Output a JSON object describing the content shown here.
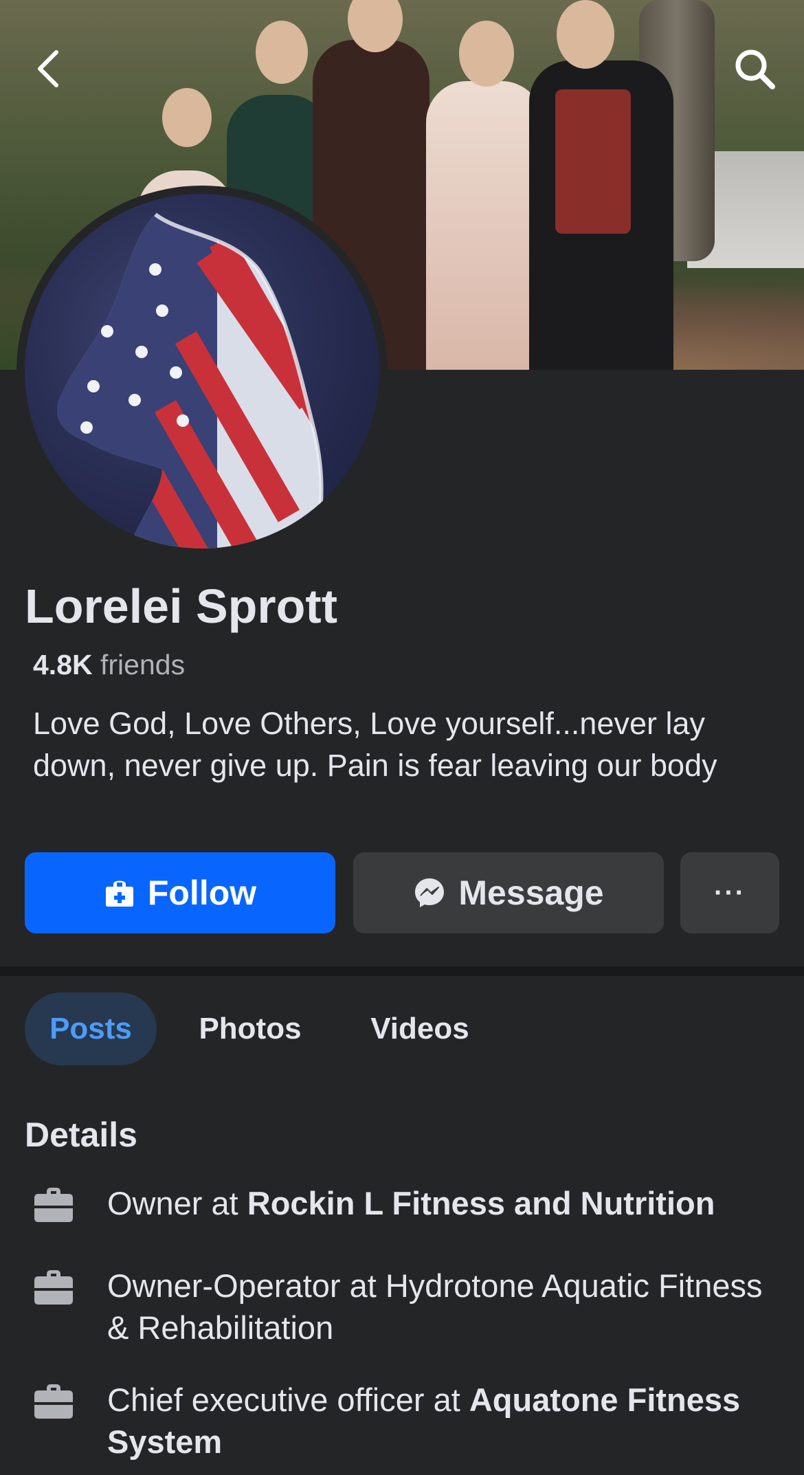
{
  "profile": {
    "name": "Lorelei Sprott",
    "friends_count": "4.8K",
    "friends_label": "friends",
    "bio": "Love God, Love Others, Love yourself...never lay down, never give up.  Pain is fear leaving our body"
  },
  "actions": {
    "follow_label": "Follow",
    "message_label": "Message",
    "more_label": "···"
  },
  "tabs": [
    {
      "label": "Posts",
      "active": true
    },
    {
      "label": "Photos",
      "active": false
    },
    {
      "label": "Videos",
      "active": false
    }
  ],
  "details": {
    "title": "Details",
    "items": [
      {
        "prefix": "Owner at ",
        "bold": "Rockin L Fitness and Nutrition",
        "icon": "briefcase-icon"
      },
      {
        "prefix": "Owner-Operator at Hydrotone Aquatic Fitness & Rehabilitation",
        "bold": "",
        "icon": "briefcase-icon"
      },
      {
        "prefix": "Chief executive officer at ",
        "bold": "Aquatone Fitness System",
        "icon": "briefcase-icon"
      }
    ]
  },
  "colors": {
    "background": "#242526",
    "primary": "#0866ff",
    "secondary_button": "#3a3b3c",
    "active_tab_bg": "#263951",
    "active_tab_text": "#4e9bf8"
  }
}
